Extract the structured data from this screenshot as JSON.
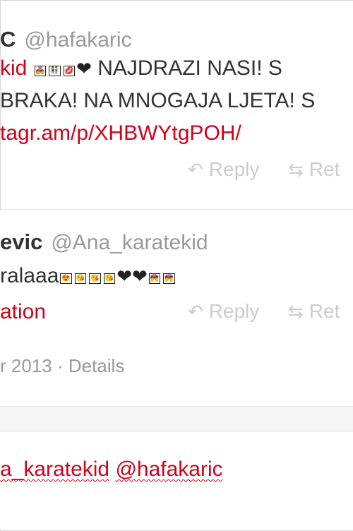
{
  "tweet1": {
    "name": "C",
    "handle": "@hafakaric",
    "line1_link": "kid",
    "line1_emojis": [
      "💑",
      "👫",
      "💋"
    ],
    "line1_heart": "❤",
    "line1_text": " NAJDRAZI NASI! S",
    "line2_text": "BRAKA! NA MNOGAJA LJETA! S",
    "line3_link": "tagr.am/p/XHBWYtgPOH/",
    "actions": {
      "reply": "Reply",
      "retweet": "Ret"
    }
  },
  "tweet2": {
    "name": "evic",
    "handle": "@Ana_karatekid",
    "text": "ralaaa",
    "emojis_a": [
      "😍",
      "😘",
      "😘",
      "😘"
    ],
    "hearts": "❤❤",
    "emojis_b": [
      "💏",
      "💏"
    ],
    "link": "ation",
    "actions": {
      "reply": "Reply",
      "retweet": "Ret"
    },
    "date": "r 2013",
    "sep": " · ",
    "details": "Details"
  },
  "reply_box": {
    "text_1": "a_karatekid",
    "text_2": "@hafakaric"
  },
  "colors": {
    "link": "#d0021b",
    "muted": "#999999",
    "action": "#cccccc"
  },
  "icons": {
    "reply": "reply-arrow-icon",
    "retweet": "retweet-icon"
  }
}
